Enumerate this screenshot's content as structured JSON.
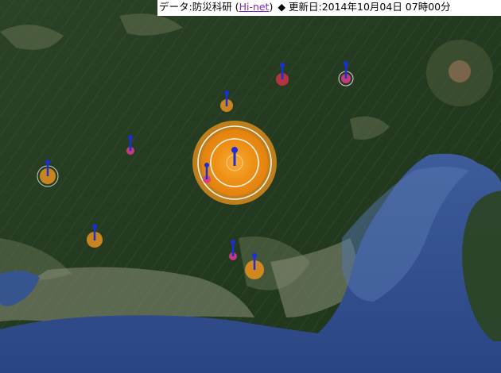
{
  "credit": {
    "prefix": "データ:防災科研 (",
    "link_text": "Hi-net",
    "suffix": ")",
    "update_label": "更新日:2014年10月04日 07時00分",
    "diamond_glyph": "◆"
  },
  "colors": {
    "quake_orange": "#f08a12",
    "quake_magenta": "#d83a86",
    "quake_red": "#cc3344",
    "pin_blue": "#1a2fd6",
    "ring_white": "#ffffff",
    "link_purple": "#7a2db0"
  },
  "markers": [
    {
      "id": "main-shock",
      "kind": "large",
      "color": "orange"
    },
    {
      "id": "pin-1",
      "kind": "small",
      "color": "orange"
    },
    {
      "id": "pin-2",
      "kind": "small",
      "color": "red"
    },
    {
      "id": "pin-3",
      "kind": "small",
      "color": "magenta"
    },
    {
      "id": "pin-4",
      "kind": "small",
      "color": "magenta"
    },
    {
      "id": "pin-5",
      "kind": "small",
      "color": "orange"
    },
    {
      "id": "pin-6",
      "kind": "small",
      "color": "magenta"
    },
    {
      "id": "pin-7",
      "kind": "small",
      "color": "orange"
    },
    {
      "id": "pin-8",
      "kind": "small",
      "color": "magenta"
    },
    {
      "id": "pin-9",
      "kind": "small",
      "color": "orange"
    }
  ]
}
